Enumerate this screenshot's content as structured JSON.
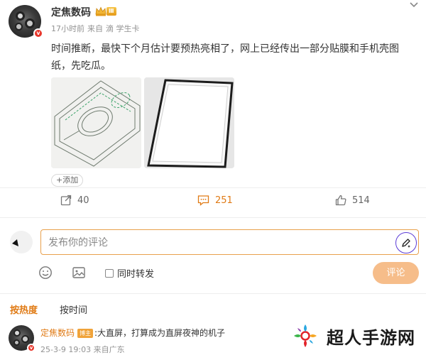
{
  "post": {
    "author": "定焦数码",
    "verify_mark": "v",
    "level_badge": "Ⅲ",
    "time": "17小时前",
    "source_prefix": "来自",
    "source_app": "滴 学生卡",
    "text": "时间推断，最快下个月估计要预热亮相了，网上已经传出一部分贴膜和手机壳图纸，先吃瓜。",
    "add_tag_label": "+添加"
  },
  "actions": {
    "repost_count": "40",
    "comment_count": "251",
    "like_count": "514"
  },
  "composer": {
    "placeholder": "发布你的评论",
    "repost_label": "同时转发",
    "submit_label": "评论"
  },
  "sort_tabs": {
    "hot": "按热度",
    "time": "按时间"
  },
  "comment": {
    "author": "定焦数码",
    "badge": "博主",
    "text": ":大直屏，打算成为直屏夜神的机子",
    "meta": "25-3-9 19:03 来自广东"
  },
  "watermark": {
    "text": "超人手游网"
  },
  "colors": {
    "accent": "#e07a14",
    "input_border": "#e8a04c",
    "submit_bg": "#f6bd8a",
    "verify_red": "#e8362b"
  }
}
